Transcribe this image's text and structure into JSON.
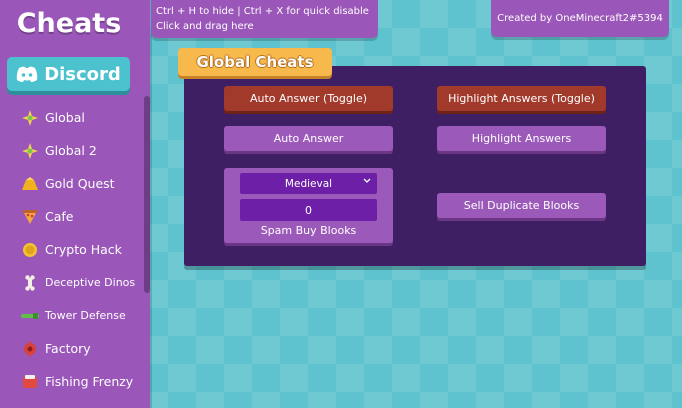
{
  "sidebar": {
    "title": "Cheats",
    "discord_label": "Discord",
    "items": [
      {
        "label": "Global",
        "icon": "sparkle-icon"
      },
      {
        "label": "Global 2",
        "icon": "sparkle-icon"
      },
      {
        "label": "Gold Quest",
        "icon": "gold-icon"
      },
      {
        "label": "Cafe",
        "icon": "pizza-icon"
      },
      {
        "label": "Crypto Hack",
        "icon": "coin-icon"
      },
      {
        "label": "Deceptive Dinos",
        "icon": "bone-icon"
      },
      {
        "label": "Tower Defense",
        "icon": "tower-icon"
      },
      {
        "label": "Factory",
        "icon": "factory-icon"
      },
      {
        "label": "Fishing Frenzy",
        "icon": "fish-icon"
      }
    ]
  },
  "hint": {
    "line1": "Ctrl + H to hide | Ctrl + X for quick disable",
    "line2": "Click and drag here"
  },
  "credit": "Created by OneMinecraft2#5394",
  "panel": {
    "tab": "Global Cheats",
    "buttons": {
      "auto_answer_toggle": "Auto Answer (Toggle)",
      "highlight_toggle": "Highlight Answers (Toggle)",
      "auto_answer": "Auto Answer",
      "highlight": "Highlight Answers",
      "sell_duplicate": "Sell Duplicate Blooks"
    },
    "buy": {
      "select_value": "Medieval",
      "number_value": "0",
      "label": "Spam Buy Blooks"
    }
  },
  "colors": {
    "sidebar": "#9a56b8",
    "panel": "#3f1f63",
    "button_active": "#a23a2c",
    "button": "#9b5ab9",
    "tab": "#f7b84c",
    "discord": "#4cc2cf",
    "background": "#5ec3ce"
  }
}
